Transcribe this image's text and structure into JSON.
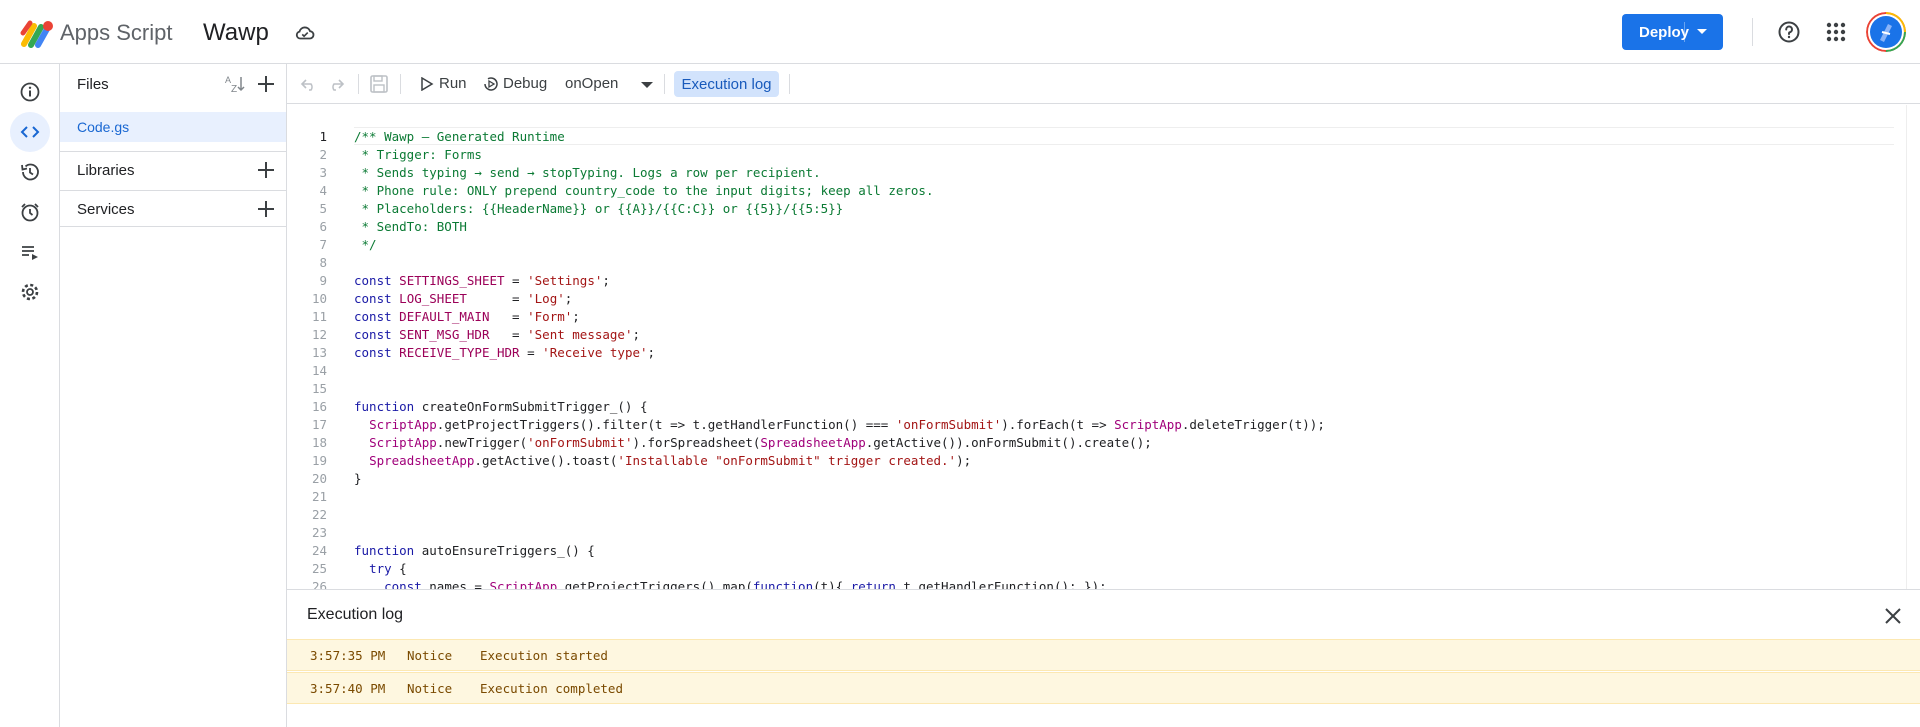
{
  "header": {
    "app_name": "Apps Script",
    "project_name": "Wawp",
    "deploy_label": "Deploy"
  },
  "files": {
    "title": "Files",
    "items": [
      {
        "name": "Code.gs"
      }
    ],
    "sections": [
      {
        "label": "Libraries"
      },
      {
        "label": "Services"
      }
    ]
  },
  "toolbar": {
    "run_label": "Run",
    "debug_label": "Debug",
    "function_name": "onOpen",
    "execution_log_label": "Execution log"
  },
  "code": {
    "lines": [
      "/** Wawp – Generated Runtime",
      " * Trigger: Forms",
      " * Sends typing → send → stopTyping. Logs a row per recipient.",
      " * Phone rule: ONLY prepend country_code to the input digits; keep all zeros.",
      " * Placeholders: {{HeaderName}} or {{A}}/{{C:C}} or {{5}}/{{5:5}}",
      " * SendTo: BOTH",
      " */",
      "",
      "const SETTINGS_SHEET = 'Settings';",
      "const LOG_SHEET      = 'Log';",
      "const DEFAULT_MAIN   = 'Form';",
      "const SENT_MSG_HDR   = 'Sent message';",
      "const RECEIVE_TYPE_HDR = 'Receive type';",
      "",
      "",
      "function createOnFormSubmitTrigger_() {",
      "  ScriptApp.getProjectTriggers().filter(t => t.getHandlerFunction() === 'onFormSubmit').forEach(t => ScriptApp.deleteTrigger(t));",
      "  ScriptApp.newTrigger('onFormSubmit').forSpreadsheet(SpreadsheetApp.getActive()).onFormSubmit().create();",
      "  SpreadsheetApp.getActive().toast('Installable \"onFormSubmit\" trigger created.');",
      "}",
      "",
      "",
      "",
      "function autoEnsureTriggers_() {",
      "  try {",
      "    const names = ScriptApp.getProjectTriggers().map(function(t){ return t.getHandlerFunction(); });"
    ]
  },
  "execution_log": {
    "title": "Execution log",
    "rows": [
      {
        "time": "3:57:35 PM",
        "level": "Notice",
        "message": "Execution started"
      },
      {
        "time": "3:57:40 PM",
        "level": "Notice",
        "message": "Execution completed"
      }
    ]
  }
}
